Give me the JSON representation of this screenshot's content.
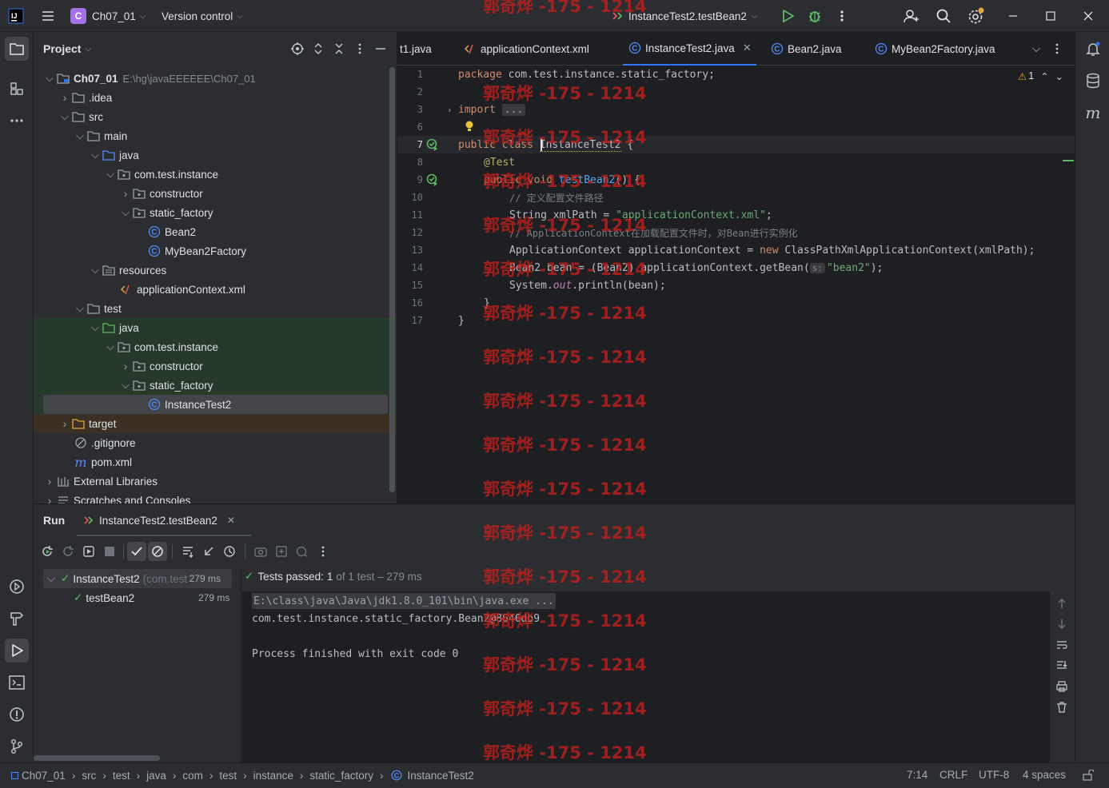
{
  "titlebar": {
    "project_badge": "C",
    "project_name": "Ch07_01",
    "vcs_label": "Version control",
    "run_config": "InstanceTest2.testBean2"
  },
  "project_panel": {
    "title": "Project",
    "root_name": "Ch07_01",
    "root_path": "E:\\hg\\javaEEEEEE\\Ch07_01",
    "tree": [
      {
        "label": "Ch07_01"
      },
      {
        "label": ".idea"
      },
      {
        "label": "src"
      },
      {
        "label": "main"
      },
      {
        "label": "java"
      },
      {
        "label": "com.test.instance"
      },
      {
        "label": "constructor"
      },
      {
        "label": "static_factory"
      },
      {
        "label": "Bean2"
      },
      {
        "label": "MyBean2Factory"
      },
      {
        "label": "resources"
      },
      {
        "label": "applicationContext.xml"
      },
      {
        "label": "test"
      },
      {
        "label": "java"
      },
      {
        "label": "com.test.instance"
      },
      {
        "label": "constructor"
      },
      {
        "label": "static_factory"
      },
      {
        "label": "InstanceTest2"
      },
      {
        "label": "target"
      },
      {
        "label": ".gitignore"
      },
      {
        "label": "pom.xml"
      },
      {
        "label": "External Libraries"
      },
      {
        "label": "Scratches and Consoles"
      }
    ]
  },
  "editor": {
    "tabs": [
      {
        "label": "t1.java"
      },
      {
        "label": "applicationContext.xml"
      },
      {
        "label": "InstanceTest2.java",
        "active": true
      },
      {
        "label": "Bean2.java"
      },
      {
        "label": "MyBean2Factory.java"
      }
    ],
    "warning_count": "1",
    "line_numbers": [
      "1",
      "2",
      "3",
      "6",
      "7",
      "8",
      "9",
      "10",
      "11",
      "12",
      "13",
      "14",
      "15",
      "16",
      "17"
    ],
    "code": {
      "l1_kw": "package",
      "l1_rest": " com.test.instance.static_factory;",
      "l3_kw": "import",
      "l3_fold": "...",
      "l7_kw": "public class",
      "l7_name": "InstanceTest2",
      "l7_rest": " {",
      "l8": "@Test",
      "l9_kw": "public void",
      "l9_fn": "testBean2",
      "l9_rest": "() {",
      "l10": "// 定义配置文件路径",
      "l11_a": "String xmlPath = ",
      "l11_str": "\"applicationContext.xml\"",
      "l11_b": ";",
      "l12": "// ApplicationContext在加载配置文件时，对Bean进行实例化",
      "l13_a": "ApplicationContext applicationContext = ",
      "l13_kw": "new",
      "l13_b": " ClassPathXmlApplicationContext(xmlPath);",
      "l14_a": "Bean2 bean = (Bean2) applicationContext.getBean(",
      "l14_hint": "s:",
      "l14_str": "\"bean2\"",
      "l14_b": ");",
      "l15_a": "System.",
      "l15_it": "out",
      "l15_b": ".println(bean);",
      "l16": "}",
      "l17": "}"
    }
  },
  "run_panel": {
    "tab_run": "Run",
    "tab_config": "InstanceTest2.testBean2",
    "tests_passed_label": "Tests passed:",
    "tests_passed_count": "1",
    "tests_passed_rest": "of 1 test – 279 ms",
    "tree": [
      {
        "name": "InstanceTest2",
        "detail": "(com.test",
        "time": "279 ms"
      },
      {
        "name": "testBean2",
        "detail": "",
        "time": "279 ms"
      }
    ],
    "console": [
      "E:\\class\\java\\Java\\jdk1.8.0_101\\bin\\java.exe ...",
      "com.test.instance.static_factory.Bean2@8646db9",
      "",
      "Process finished with exit code 0"
    ]
  },
  "statusbar": {
    "breadcrumbs": [
      "Ch07_01",
      "src",
      "test",
      "java",
      "com",
      "test",
      "instance",
      "static_factory",
      "InstanceTest2"
    ],
    "position": "7:14",
    "line_sep": "CRLF",
    "encoding": "UTF-8",
    "indent": "4 spaces"
  },
  "watermark": "郭奇烨 -175 - 1214",
  "colors": {
    "accent": "#3574f0",
    "success": "#5fb865",
    "watermark": "#c0201e"
  }
}
